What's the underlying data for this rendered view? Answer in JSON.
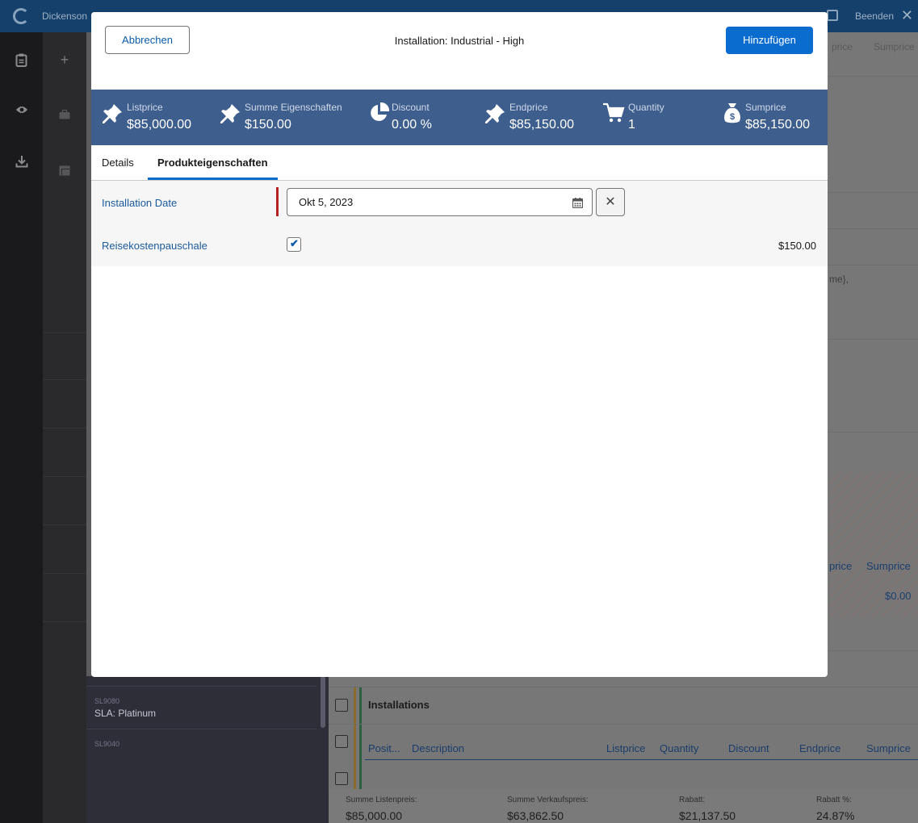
{
  "background": {
    "topbar": {
      "title": "Dickenson",
      "end_label": "Beenden"
    },
    "right_headers": [
      "price",
      "Sumprice"
    ],
    "right_fragment": "me},",
    "hatched_table": {
      "col1": "price",
      "col2": "Sumprice",
      "value": "$0.00"
    },
    "list_items": [
      {
        "code": "SL9080",
        "name": "SLA: Platinum"
      },
      {
        "code": "SL9040",
        "name": ""
      }
    ],
    "group_title": "Installations",
    "table_headers": [
      "Posit...",
      "Description",
      "Listprice",
      "Quantity",
      "Discount",
      "Endprice",
      "Sumprice"
    ],
    "footer": {
      "summe_listenpreis_label": "Summe Listenpreis:",
      "summe_listenpreis_value": "$85,000.00",
      "summe_verkaufspreis_label": "Summe Verkaufspreis:",
      "summe_verkaufspreis_value": "$63,862.50",
      "rabatt_label": "Rabatt:",
      "rabatt_value": "$21,137.50",
      "rabatt_pct_label": "Rabatt %:",
      "rabatt_pct_value": "24.87%"
    }
  },
  "modal": {
    "cancel_label": "Abbrechen",
    "title": "Installation: Industrial - High",
    "add_label": "Hinzufügen",
    "stats": [
      {
        "icon": "pin-icon",
        "label": "Listprice",
        "value": "$85,000.00"
      },
      {
        "icon": "pin-icon",
        "label": "Summe Eigenschaften",
        "value": "$150.00"
      },
      {
        "icon": "pie-chart-icon",
        "label": "Discount",
        "value": "0.00 %"
      },
      {
        "icon": "pin-icon",
        "label": "Endprice",
        "value": "$85,150.00"
      },
      {
        "icon": "cart-icon",
        "label": "Quantity",
        "value": "1"
      },
      {
        "icon": "money-bag-icon",
        "label": "Sumprice",
        "value": "$85,150.00"
      }
    ],
    "tabs": [
      {
        "label": "Details",
        "active": false
      },
      {
        "label": "Produkteigenschaften",
        "active": true
      }
    ],
    "properties": {
      "installation_date": {
        "label": "Installation Date",
        "value": "Okt 5, 2023"
      },
      "reisekosten": {
        "label": "Reisekostenpauschale",
        "checked": true,
        "price": "$150.00"
      }
    }
  },
  "colors": {
    "accent": "#0b6cd0",
    "statbar": "#3e5e8e",
    "required": "#b32222"
  }
}
